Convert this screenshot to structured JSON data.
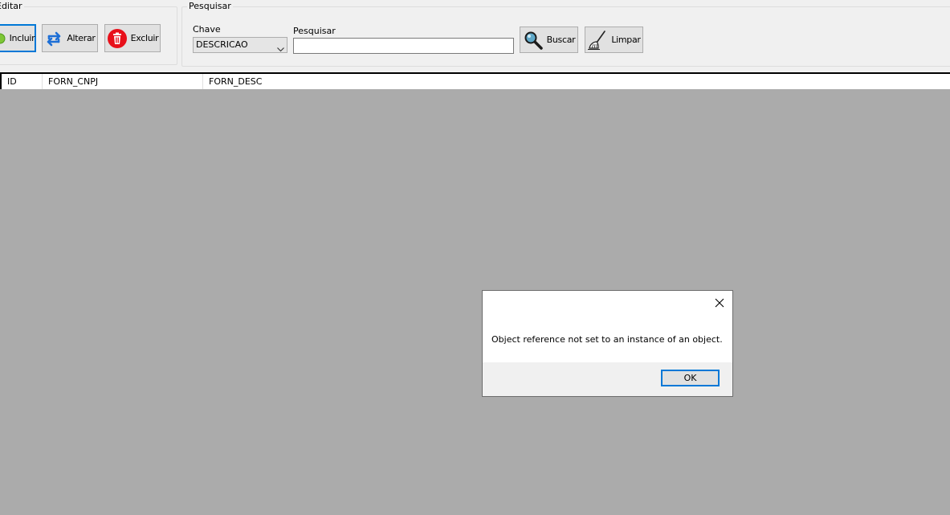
{
  "editar": {
    "group_label": "Editar",
    "incluir_label": "Incluir",
    "alterar_label": "Alterar",
    "excluir_label": "Excluir"
  },
  "pesquisar": {
    "group_label": "Pesquisar",
    "chave_label": "Chave",
    "chave_value": "DESCRICAO",
    "pesquisar_label": "Pesquisar",
    "pesquisar_value": "",
    "buscar_label": "Buscar",
    "limpar_label": "Limpar"
  },
  "grid": {
    "columns": [
      "ID",
      "FORN_CNPJ",
      "FORN_DESC"
    ]
  },
  "dialog": {
    "message": "Object reference not set to an instance of an object.",
    "ok_label": "OK"
  },
  "colors": {
    "accent": "#0078d7",
    "grid_background": "#ababab",
    "window_background": "#f0f0f0"
  },
  "icons": {
    "incluir": "green-circle-icon",
    "alterar": "swap-arrows-icon",
    "excluir": "trash-icon",
    "buscar": "magnifier-icon",
    "limpar": "broom-icon",
    "dialog_close": "close-icon"
  }
}
